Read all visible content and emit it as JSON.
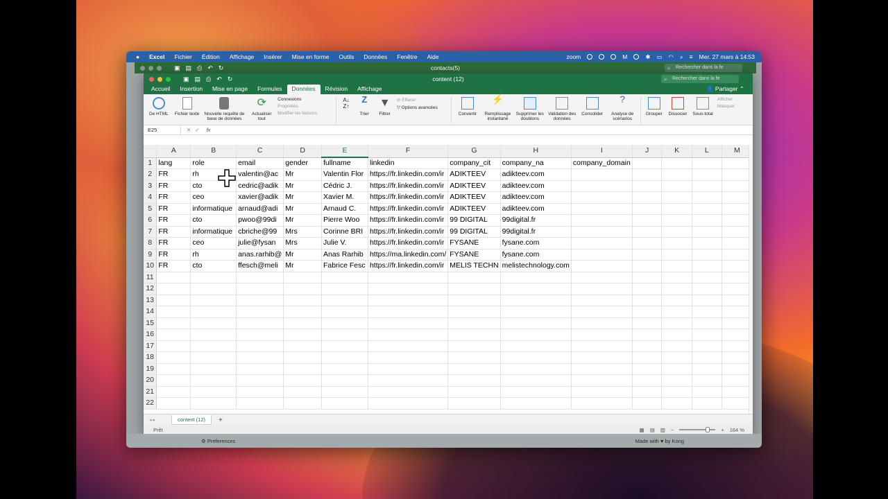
{
  "menubar": {
    "apple": "",
    "items": [
      "Excel",
      "Fichier",
      "Édition",
      "Affichage",
      "Insérer",
      "Mise en forme",
      "Outils",
      "Données",
      "Fenêtre",
      "Aide"
    ],
    "zoom": "zoom",
    "clock": "Mer. 27 mars à 14:53"
  },
  "back_window": {
    "title": "contacts(5)",
    "search_placeholder": "Rechercher dans la fe"
  },
  "window": {
    "title": "content (12)",
    "search_placeholder": "Rechercher dans la fe"
  },
  "tabs": [
    "Accueil",
    "Insertion",
    "Mise en page",
    "Formules",
    "Données",
    "Révision",
    "Affichage"
  ],
  "active_tab": "Données",
  "share": "Partager",
  "ribbon": {
    "get_html": "De HTML",
    "get_text": "Fichier texte",
    "new_query": "Nouvelle requête de base de données",
    "connections": "Connexions",
    "properties": "Propriétés",
    "edit_links": "Modifier les liaisons",
    "refresh_all": "Actualiser tout",
    "sort_az": "",
    "sort": "Trier",
    "filter": "Filtrer",
    "clear": "Effacer",
    "advanced": "Options avancées",
    "convert": "Convertir",
    "flash_fill": "Remplissage instantané",
    "remove_dup": "Supprimer les doublons",
    "validation": "Validation des données",
    "consolidate": "Consolider",
    "whatif": "Analyse de scénarios",
    "group": "Grouper",
    "ungroup": "Dissocier",
    "subtotal": "Sous-total",
    "show": "Afficher",
    "hide": "Masquer"
  },
  "formula_bar": {
    "name_box": "E25",
    "fx": "fx",
    "value": ""
  },
  "columns": [
    "A",
    "B",
    "C",
    "D",
    "E",
    "F",
    "G",
    "H",
    "I",
    "J",
    "K",
    "L",
    "M"
  ],
  "selected_column": "E",
  "rows": [
    [
      "lang",
      "role",
      "email",
      "gender",
      "fullname",
      "linkedin",
      "company_cit",
      "company_na",
      "company_domain",
      "",
      "",
      "",
      ""
    ],
    [
      "FR",
      "rh",
      "valentin@ac",
      "Mr",
      "Valentin Flor",
      "https://fr.linkedin.com/ir",
      "ADIKTEEV",
      "adikteev.com",
      "",
      "",
      "",
      "",
      ""
    ],
    [
      "FR",
      "cto",
      "cedric@adik",
      "Mr",
      "Cédric J.",
      "https://fr.linkedin.com/ir",
      "ADIKTEEV",
      "adikteev.com",
      "",
      "",
      "",
      "",
      ""
    ],
    [
      "FR",
      "ceo",
      "xavier@adik",
      "Mr",
      "Xavier M.",
      "https://fr.linkedin.com/ir",
      "ADIKTEEV",
      "adikteev.com",
      "",
      "",
      "",
      "",
      ""
    ],
    [
      "FR",
      "informatique",
      "arnaud@adi",
      "Mr",
      "Arnaud C.",
      "https://fr.linkedin.com/ir",
      "ADIKTEEV",
      "adikteev.com",
      "",
      "",
      "",
      "",
      ""
    ],
    [
      "FR",
      "cto",
      "pwoo@99di",
      "Mr",
      "Pierre Woo",
      "https://fr.linkedin.com/ir",
      "99 DIGITAL",
      "99digital.fr",
      "",
      "",
      "",
      "",
      ""
    ],
    [
      "FR",
      "informatique",
      "cbriche@99",
      "Mrs",
      "Corinne BRI",
      "https://fr.linkedin.com/ir",
      "99 DIGITAL",
      "99digital.fr",
      "",
      "",
      "",
      "",
      ""
    ],
    [
      "FR",
      "ceo",
      "julie@fysan",
      "Mrs",
      "Julie V.",
      "https://fr.linkedin.com/ir",
      "FYSANE",
      "fysane.com",
      "",
      "",
      "",
      "",
      ""
    ],
    [
      "FR",
      "rh",
      "anas.rarhib@",
      "Mr",
      "Anas Rarhib",
      "https://ma.linkedin.com/",
      "FYSANE",
      "fysane.com",
      "",
      "",
      "",
      "",
      ""
    ],
    [
      "FR",
      "cto",
      "ffesch@meli",
      "Mr",
      "Fabrice Fesc",
      "https://fr.linkedin.com/ir",
      "MELIS TECHN",
      "melistechnology.com",
      "",
      "",
      "",
      "",
      ""
    ],
    [
      "",
      "",
      "",
      "",
      "",
      "",
      "",
      "",
      "",
      "",
      "",
      "",
      ""
    ],
    [
      "",
      "",
      "",
      "",
      "",
      "",
      "",
      "",
      "",
      "",
      "",
      "",
      ""
    ],
    [
      "",
      "",
      "",
      "",
      "",
      "",
      "",
      "",
      "",
      "",
      "",
      "",
      ""
    ],
    [
      "",
      "",
      "",
      "",
      "",
      "",
      "",
      "",
      "",
      "",
      "",
      "",
      ""
    ],
    [
      "",
      "",
      "",
      "",
      "",
      "",
      "",
      "",
      "",
      "",
      "",
      "",
      ""
    ],
    [
      "",
      "",
      "",
      "",
      "",
      "",
      "",
      "",
      "",
      "",
      "",
      "",
      ""
    ],
    [
      "",
      "",
      "",
      "",
      "",
      "",
      "",
      "",
      "",
      "",
      "",
      "",
      ""
    ],
    [
      "",
      "",
      "",
      "",
      "",
      "",
      "",
      "",
      "",
      "",
      "",
      "",
      ""
    ],
    [
      "",
      "",
      "",
      "",
      "",
      "",
      "",
      "",
      "",
      "",
      "",
      "",
      ""
    ],
    [
      "",
      "",
      "",
      "",
      "",
      "",
      "",
      "",
      "",
      "",
      "",
      "",
      ""
    ],
    [
      "",
      "",
      "",
      "",
      "",
      "",
      "",
      "",
      "",
      "",
      "",
      "",
      ""
    ],
    [
      "",
      "",
      "",
      "",
      "",
      "",
      "",
      "",
      "",
      "",
      "",
      "",
      ""
    ]
  ],
  "sheet_tab": "content (12)",
  "status": {
    "ready": "Prêt",
    "zoom": "164 %"
  },
  "footer": {
    "preferences": "Preferences",
    "made_with": "Made with ♥ by Kong"
  }
}
